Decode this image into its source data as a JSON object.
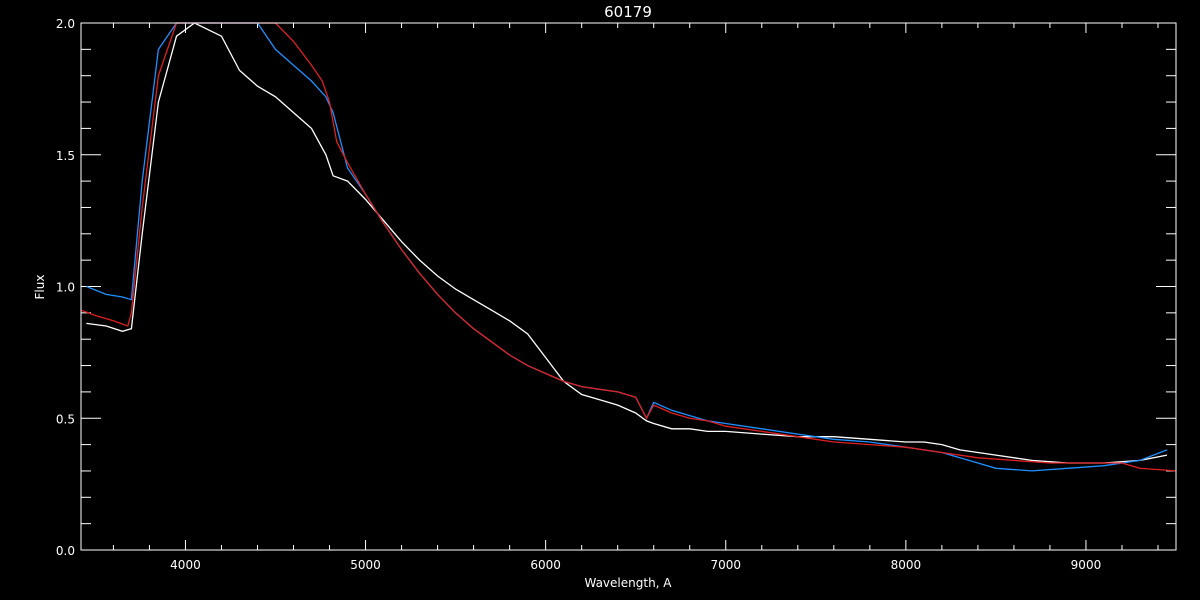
{
  "chart_data": {
    "type": "line",
    "title": "60179",
    "xlabel": "Wavelength, A",
    "ylabel": "Flux",
    "xlim": [
      3420,
      9500
    ],
    "ylim": [
      0,
      2
    ],
    "x_ticks": [
      4000,
      5000,
      6000,
      7000,
      8000,
      9000
    ],
    "y_ticks": [
      0.0,
      0.5,
      1.0,
      1.5,
      2.0
    ],
    "x_tick_labels": [
      "4000",
      "5000",
      "6000",
      "7000",
      "8000",
      "9000"
    ],
    "y_tick_labels": [
      "0.0",
      "0.5",
      "1.0",
      "1.5",
      "2.0"
    ],
    "grid": false,
    "series": [
      {
        "color": "#ffffff",
        "x": [
          3450,
          3560,
          3650,
          3700,
          3760,
          3850,
          3950,
          4050,
          4200,
          4300,
          4400,
          4500,
          4600,
          4700,
          4780,
          4820,
          4900,
          5000,
          5100,
          5200,
          5300,
          5400,
          5500,
          5600,
          5700,
          5800,
          5900,
          6000,
          6100,
          6200,
          6300,
          6400,
          6500,
          6560,
          6600,
          6700,
          6800,
          6900,
          7000,
          7200,
          7400,
          7600,
          7800,
          8000,
          8100,
          8200,
          8300,
          8400,
          8500,
          8700,
          8900,
          9100,
          9300,
          9450
        ],
        "y": [
          0.86,
          0.85,
          0.83,
          0.84,
          1.2,
          1.7,
          1.95,
          2.0,
          1.95,
          1.82,
          1.76,
          1.72,
          1.66,
          1.6,
          1.5,
          1.42,
          1.4,
          1.33,
          1.25,
          1.17,
          1.1,
          1.04,
          0.99,
          0.95,
          0.91,
          0.87,
          0.82,
          0.73,
          0.64,
          0.59,
          0.57,
          0.55,
          0.52,
          0.49,
          0.48,
          0.46,
          0.46,
          0.45,
          0.45,
          0.44,
          0.43,
          0.43,
          0.42,
          0.41,
          0.41,
          0.4,
          0.38,
          0.37,
          0.36,
          0.34,
          0.33,
          0.33,
          0.34,
          0.36
        ]
      },
      {
        "color": "#1e90ff",
        "x": [
          3450,
          3560,
          3650,
          3700,
          3760,
          3850,
          3950,
          4050,
          4200,
          4300,
          4400,
          4500,
          4600,
          4700,
          4780,
          4820,
          4900,
          5000,
          5100,
          5200,
          5300,
          5400,
          5500,
          5600,
          5700,
          5800,
          5900,
          6000,
          6100,
          6200,
          6300,
          6400,
          6500,
          6560,
          6600,
          6700,
          6800,
          6900,
          7000,
          7200,
          7400,
          7600,
          7800,
          8000,
          8100,
          8200,
          8300,
          8400,
          8500,
          8700,
          8900,
          9100,
          9300,
          9450
        ],
        "y": [
          1.0,
          0.97,
          0.96,
          0.95,
          1.4,
          1.9,
          2.0,
          2.0,
          2.0,
          2.0,
          2.0,
          1.9,
          1.84,
          1.78,
          1.72,
          1.66,
          1.45,
          1.35,
          1.24,
          1.14,
          1.05,
          0.97,
          0.9,
          0.84,
          0.79,
          0.74,
          0.7,
          0.67,
          0.64,
          0.62,
          0.61,
          0.6,
          0.58,
          0.5,
          0.56,
          0.53,
          0.51,
          0.49,
          0.48,
          0.46,
          0.44,
          0.42,
          0.41,
          0.39,
          0.38,
          0.37,
          0.35,
          0.33,
          0.31,
          0.3,
          0.31,
          0.32,
          0.34,
          0.38
        ]
      },
      {
        "color": "#e02020",
        "x": [
          3420,
          3500,
          3600,
          3680,
          3700,
          3760,
          3850,
          3950,
          4050,
          4200,
          4300,
          4400,
          4500,
          4600,
          4700,
          4760,
          4800,
          4840,
          4900,
          5000,
          5100,
          5200,
          5300,
          5400,
          5500,
          5600,
          5700,
          5800,
          5900,
          6000,
          6100,
          6200,
          6300,
          6400,
          6500,
          6560,
          6600,
          6700,
          6800,
          6900,
          7000,
          7200,
          7400,
          7600,
          7800,
          8000,
          8200,
          8400,
          8600,
          8800,
          9000,
          9200,
          9300,
          9500
        ],
        "y": [
          0.91,
          0.89,
          0.87,
          0.85,
          0.9,
          1.3,
          1.8,
          2.0,
          2.0,
          2.0,
          2.0,
          2.0,
          2.0,
          1.93,
          1.84,
          1.78,
          1.7,
          1.55,
          1.47,
          1.35,
          1.24,
          1.14,
          1.05,
          0.97,
          0.9,
          0.84,
          0.79,
          0.74,
          0.7,
          0.67,
          0.64,
          0.62,
          0.61,
          0.6,
          0.58,
          0.5,
          0.55,
          0.52,
          0.5,
          0.49,
          0.47,
          0.45,
          0.43,
          0.41,
          0.4,
          0.39,
          0.37,
          0.35,
          0.34,
          0.33,
          0.33,
          0.33,
          0.31,
          0.3
        ]
      }
    ]
  }
}
